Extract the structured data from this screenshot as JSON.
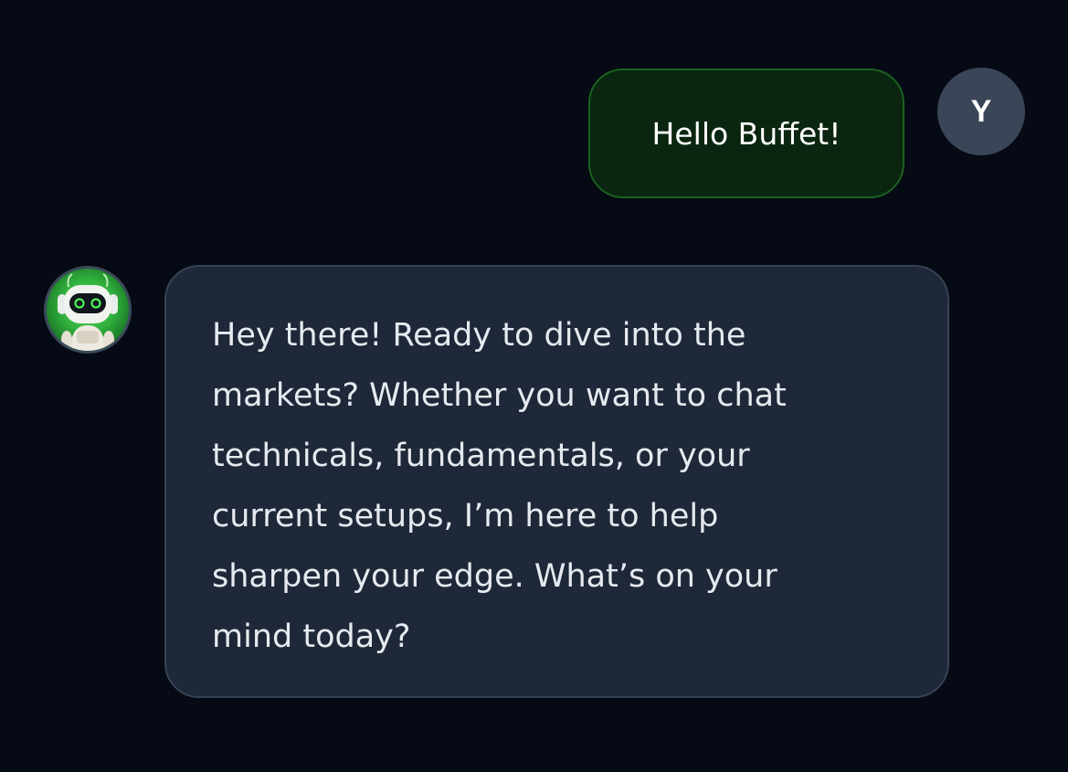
{
  "messages": {
    "user": {
      "avatar_initial": "Y",
      "text": "Hello Buffet!"
    },
    "assistant": {
      "avatar_icon": "robot-icon",
      "lines": [
        "Hey there! Ready to dive into the",
        "markets? Whether you want to chat",
        "technicals, fundamentals, or your",
        "current setups, I’m here to help",
        "sharpen your edge. What’s on your",
        "mind today?"
      ]
    }
  },
  "colors": {
    "background": "#050a14",
    "user_bubble": "#0a2510",
    "user_bubble_border": "#1b6220",
    "assistant_bubble": "#1f2838",
    "assistant_bubble_border": "#364354",
    "user_avatar": "#3a4657",
    "bot_accent": "#3ddc4b"
  }
}
